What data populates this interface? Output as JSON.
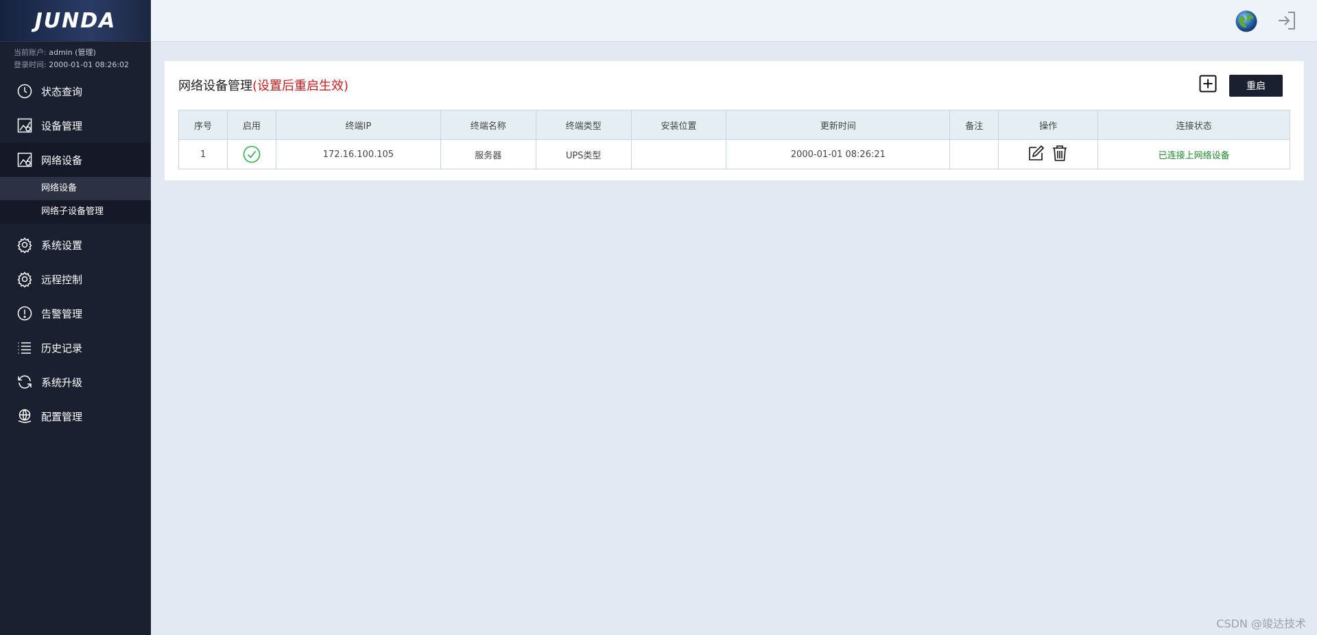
{
  "brand": {
    "logo_text": "JUNDA"
  },
  "account": {
    "user_label": "当前账户:",
    "user_value": "admin (管理)",
    "login_label": "登录时间:",
    "login_value": "2000-01-01 08:26:02"
  },
  "sidebar": {
    "items": [
      {
        "label": "状态查询",
        "icon": "clock-icon"
      },
      {
        "label": "设备管理",
        "icon": "device-chart-icon"
      },
      {
        "label": "网络设备",
        "icon": "network-chart-icon"
      },
      {
        "label": "系统设置",
        "icon": "gear-icon"
      },
      {
        "label": "远程控制",
        "icon": "gear-icon"
      },
      {
        "label": "告警管理",
        "icon": "alert-icon"
      },
      {
        "label": "历史记录",
        "icon": "list-icon"
      },
      {
        "label": "系统升级",
        "icon": "refresh-icon"
      },
      {
        "label": "配置管理",
        "icon": "globe-hand-icon"
      }
    ],
    "submenu": [
      {
        "label": "网络设备"
      },
      {
        "label": "网络子设备管理"
      }
    ]
  },
  "panel": {
    "title": "网络设备管理",
    "note": "(设置后重启生效)",
    "restart_label": "重启"
  },
  "table": {
    "headers": [
      "序号",
      "启用",
      "终端IP",
      "终端名称",
      "终端类型",
      "安装位置",
      "更新时间",
      "备注",
      "操作",
      "连接状态"
    ],
    "rows": [
      {
        "index": "1",
        "enabled": true,
        "ip": "172.16.100.105",
        "name": "服务器",
        "type": "UPS类型",
        "location": "",
        "updated": "2000-01-01 08:26:21",
        "remark": "",
        "status": "已连接上网络设备"
      }
    ]
  },
  "colors": {
    "sidebar_bg": "#1b2031",
    "status_ok": "#1f8b2a",
    "note_red": "#d31919",
    "enabled_green": "#2bb24c"
  },
  "watermark": "CSDN @竣达技术"
}
